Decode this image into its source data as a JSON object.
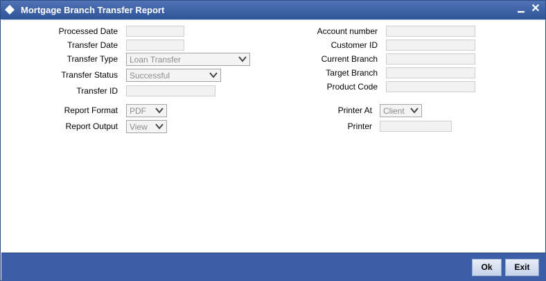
{
  "window": {
    "title": "Mortgage Branch Transfer Report",
    "minimize_symbol": "▁",
    "close_symbol": "✕"
  },
  "left_fields": {
    "processed_date": {
      "label": "Processed Date",
      "value": ""
    },
    "transfer_date": {
      "label": "Transfer Date",
      "value": ""
    },
    "transfer_type": {
      "label": "Transfer Type",
      "value": "Loan Transfer"
    },
    "transfer_status": {
      "label": "Transfer Status",
      "value": "Successful"
    },
    "transfer_id": {
      "label": "Transfer ID",
      "value": ""
    },
    "report_format": {
      "label": "Report Format",
      "value": "PDF"
    },
    "report_output": {
      "label": "Report Output",
      "value": "View"
    }
  },
  "right_fields": {
    "account_number": {
      "label": "Account number",
      "value": ""
    },
    "customer_id": {
      "label": "Customer ID",
      "value": ""
    },
    "current_branch": {
      "label": "Current Branch",
      "value": ""
    },
    "target_branch": {
      "label": "Target Branch",
      "value": ""
    },
    "product_code": {
      "label": "Product Code",
      "value": ""
    },
    "printer_at": {
      "label": "Printer At",
      "value": "Client"
    },
    "printer": {
      "label": "Printer",
      "value": ""
    }
  },
  "footer": {
    "ok_label": "Ok",
    "exit_label": "Exit"
  },
  "colors": {
    "titlebar": "#3b5ea6",
    "footer": "#3b5ea6",
    "field_bg": "#f2f2f2"
  },
  "icons": {
    "title": "diamond-icon",
    "dropdown": "chevron-down-icon"
  }
}
